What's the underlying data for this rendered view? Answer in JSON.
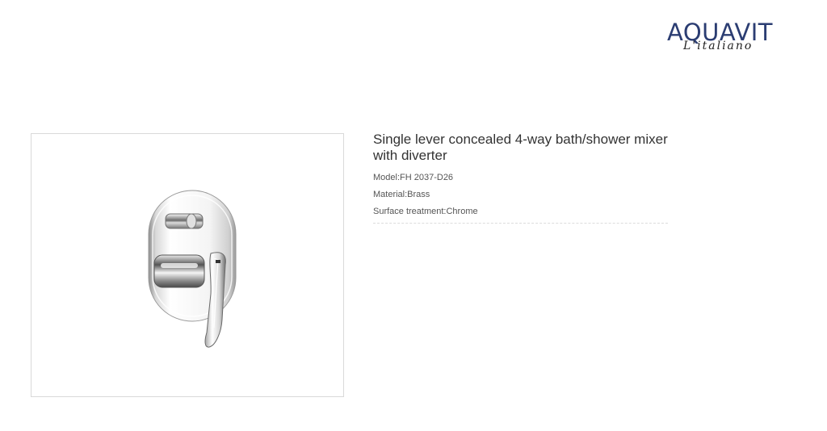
{
  "brand": {
    "name": "AQUAVIT",
    "tagline": "L'italiano",
    "color": "#2b3d72"
  },
  "product": {
    "title": "Single lever concealed 4-way bath/shower mixer with diverter",
    "image_subject": "chrome-concealed-mixer",
    "specs": {
      "model": "Model:FH 2037-D26",
      "material": "Material:Brass",
      "surface": "Surface treatment:Chrome"
    }
  }
}
